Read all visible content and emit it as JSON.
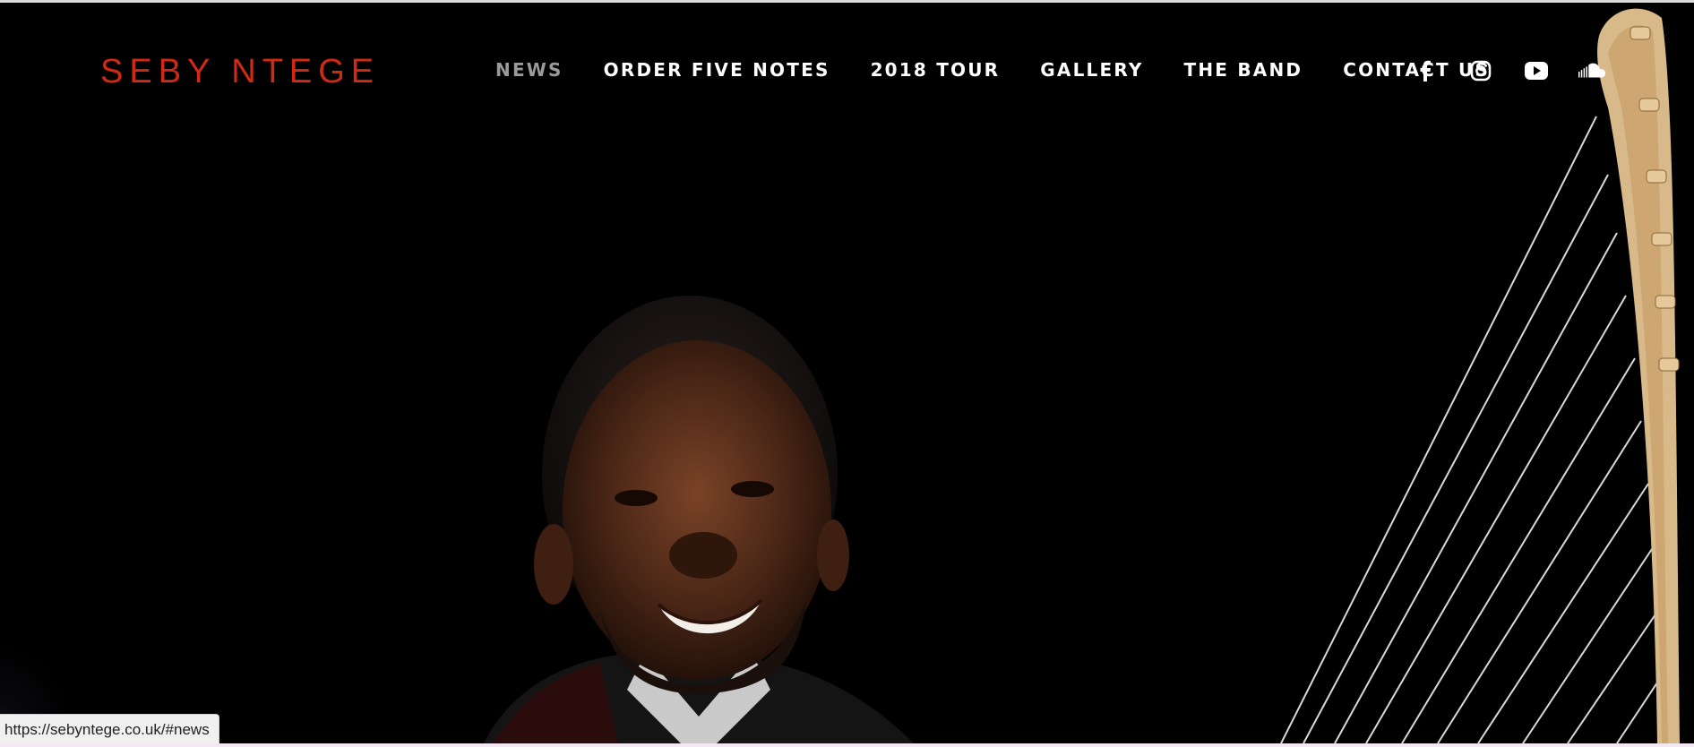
{
  "site": {
    "logo": "SEBY NTEGE"
  },
  "nav": {
    "items": [
      {
        "label": "NEWS",
        "active": true
      },
      {
        "label": "ORDER FIVE NOTES",
        "active": false
      },
      {
        "label": "2018 TOUR",
        "active": false
      },
      {
        "label": "GALLERY",
        "active": false
      },
      {
        "label": "THE BAND",
        "active": false
      },
      {
        "label": "CONTACT US",
        "active": false
      }
    ]
  },
  "social": {
    "icons": [
      "facebook-icon",
      "instagram-icon",
      "youtube-icon",
      "soundcloud-icon"
    ]
  },
  "status_bar": {
    "url": "https://sebyntege.co.uk/#news"
  },
  "colors": {
    "logo": "#d12a14",
    "nav_text": "#ffffff",
    "nav_active": "#9a9a9a",
    "background": "#000000"
  }
}
